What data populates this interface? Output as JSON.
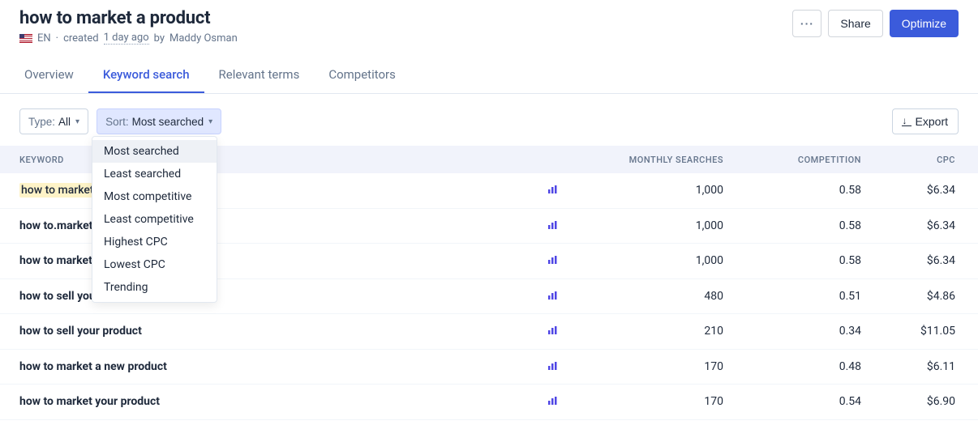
{
  "header": {
    "title": "how to market a product",
    "locale": "EN",
    "created_prefix": "created",
    "created_time": "1 day ago",
    "by": "by",
    "author": "Maddy Osman"
  },
  "actions": {
    "more": "···",
    "share": "Share",
    "optimize": "Optimize"
  },
  "tabs": [
    {
      "id": "overview",
      "label": "Overview"
    },
    {
      "id": "keyword",
      "label": "Keyword search"
    },
    {
      "id": "terms",
      "label": "Relevant terms"
    },
    {
      "id": "competitors",
      "label": "Competitors"
    }
  ],
  "active_tab": "keyword",
  "filters": {
    "type_label": "Type:",
    "type_value": "All",
    "sort_label": "Sort:",
    "sort_value": "Most searched"
  },
  "export_label": "Export",
  "sort_options": [
    "Most searched",
    "Least searched",
    "Most competitive",
    "Least competitive",
    "Highest CPC",
    "Lowest CPC",
    "Trending"
  ],
  "columns": {
    "keyword": "KEYWORD",
    "monthly": "MONTHLY SEARCHES",
    "competition": "COMPETITION",
    "cpc": "CPC"
  },
  "rows": [
    {
      "keyword": "how to market a product",
      "highlighted": true,
      "monthly": "1,000",
      "competition": "0.58",
      "cpc": "$6.34"
    },
    {
      "keyword": "how to.market a product",
      "highlighted": false,
      "monthly": "1,000",
      "competition": "0.58",
      "cpc": "$6.34"
    },
    {
      "keyword": "how to market product",
      "highlighted": false,
      "monthly": "1,000",
      "competition": "0.58",
      "cpc": "$6.34"
    },
    {
      "keyword": "how to sell your product on amazon",
      "highlighted": false,
      "monthly": "480",
      "competition": "0.51",
      "cpc": "$4.86"
    },
    {
      "keyword": "how to sell your product",
      "highlighted": false,
      "monthly": "210",
      "competition": "0.34",
      "cpc": "$11.05"
    },
    {
      "keyword": "how to market a new product",
      "highlighted": false,
      "monthly": "170",
      "competition": "0.48",
      "cpc": "$6.11"
    },
    {
      "keyword": "how to market your product",
      "highlighted": false,
      "monthly": "170",
      "competition": "0.54",
      "cpc": "$6.90"
    }
  ]
}
